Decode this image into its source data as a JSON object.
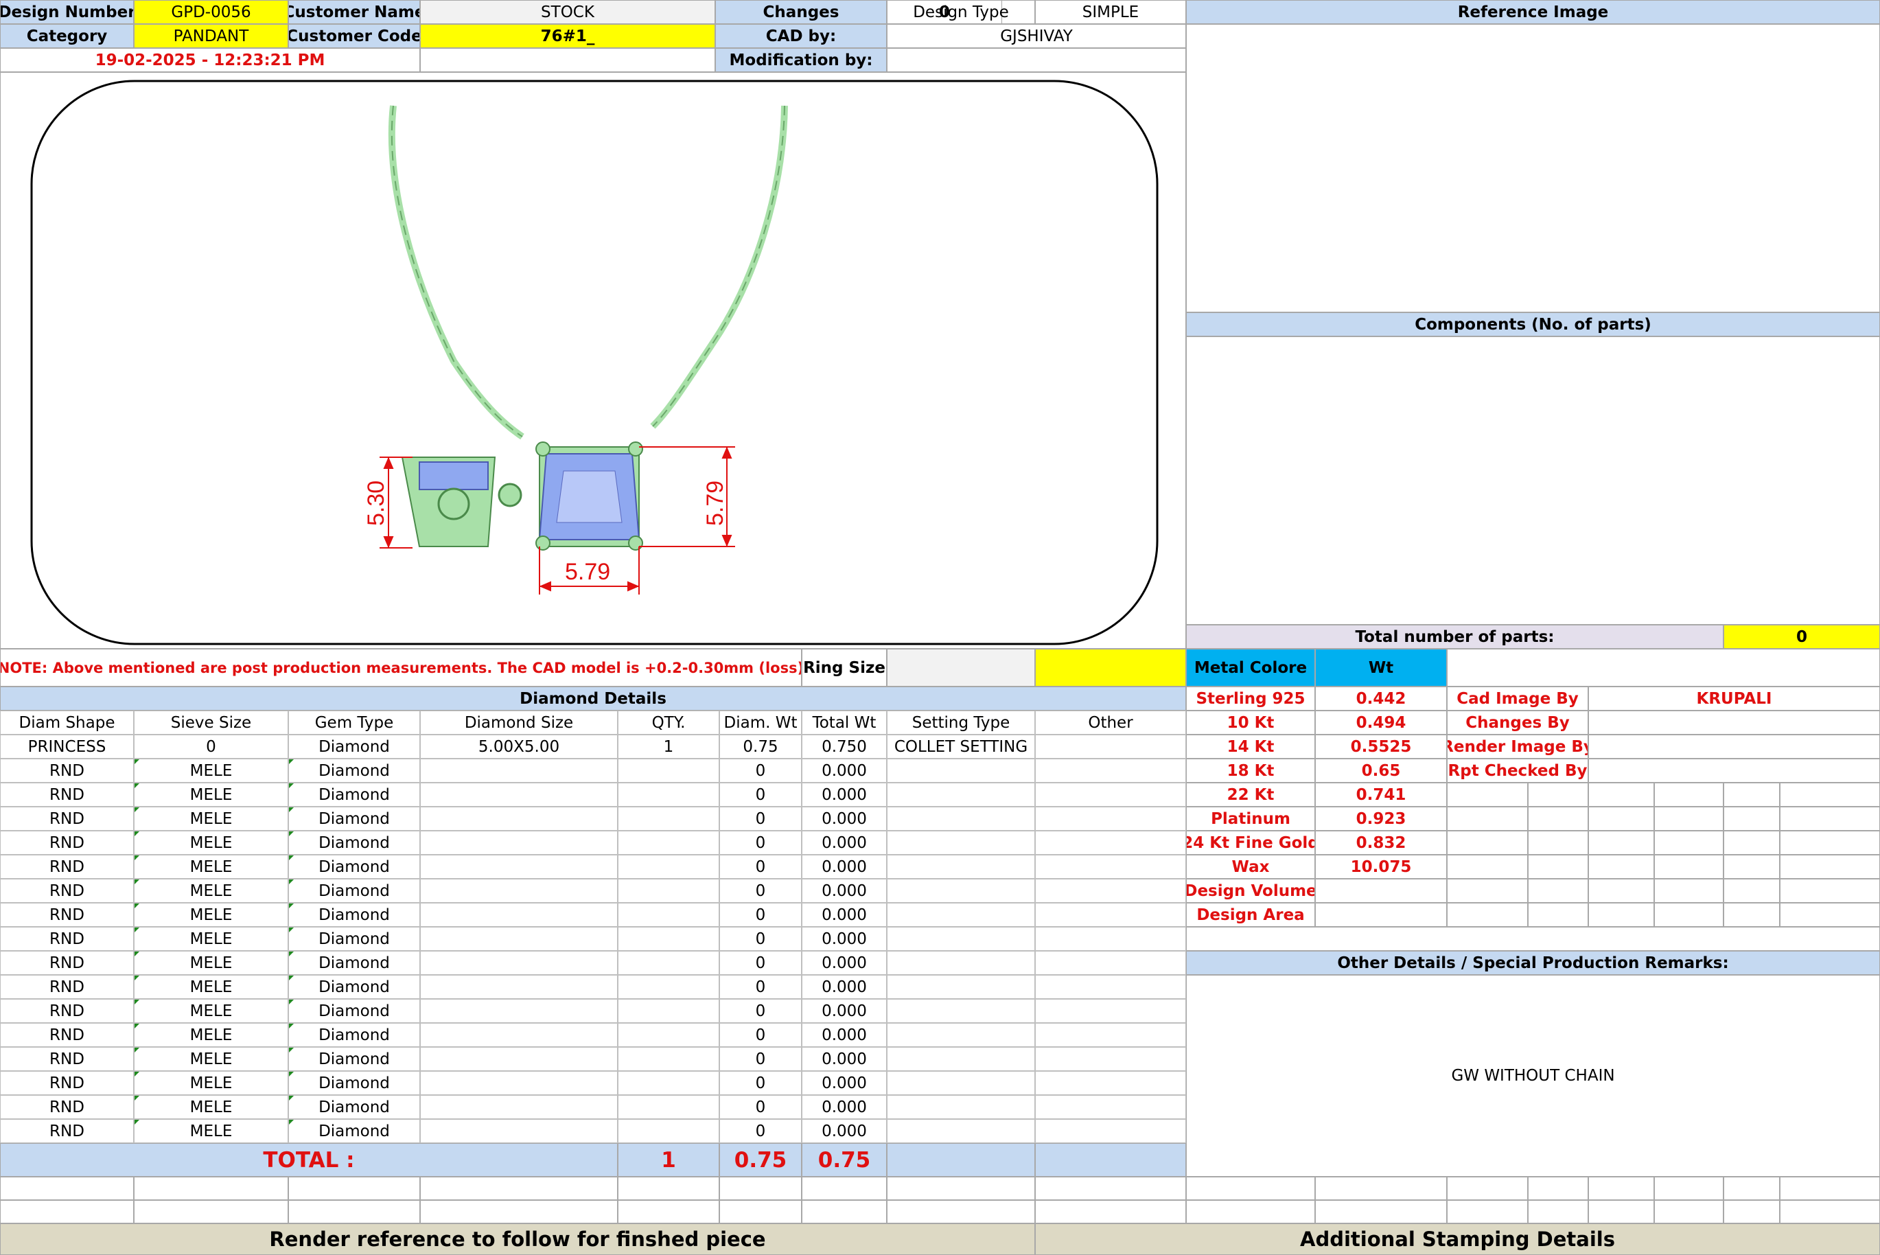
{
  "header": {
    "design_number_label": "Design Number",
    "design_number": "GPD-0056",
    "customer_name_label": "Customer Name",
    "customer_name": "STOCK",
    "changes_label": "Changes",
    "changes": "0",
    "design_type_label": "Design Type",
    "design_type": "SIMPLE",
    "reference_image_label": "Reference Image",
    "category_label": "Category",
    "category": "PANDANT",
    "customer_code_label": "Customer Code",
    "customer_code": "76#1_",
    "cad_by_label": "CAD by:",
    "cad_by": "GJSHIVAY",
    "timestamp": "19-02-2025 - 12:23:21 PM",
    "modification_by_label": "Modification by:",
    "modification_by": ""
  },
  "drawing": {
    "dim_side_height": "5.30",
    "dim_front_height": "5.79",
    "dim_front_width": "5.79"
  },
  "components": {
    "title": "Components (No. of parts)",
    "total_label": "Total number of parts:",
    "total_value": "0"
  },
  "note": "NOTE: Above mentioned are post production measurements. The CAD model is +0.2-0.30mm (loss)",
  "ring_size_label": "Ring Size",
  "ring_size": "",
  "metal": {
    "color_label": "Metal Colore",
    "wt_label": "Wt",
    "rows": [
      {
        "name": "Sterling 925",
        "wt": "0.442"
      },
      {
        "name": "10 Kt",
        "wt": "0.494"
      },
      {
        "name": "14 Kt",
        "wt": "0.5525"
      },
      {
        "name": "18 Kt",
        "wt": "0.65"
      },
      {
        "name": "22 Kt",
        "wt": "0.741"
      },
      {
        "name": "Platinum",
        "wt": "0.923"
      },
      {
        "name": "24 Kt Fine Gold",
        "wt": "0.832"
      },
      {
        "name": "Wax",
        "wt": "10.075"
      },
      {
        "name": "Design Volume",
        "wt": ""
      },
      {
        "name": "Design Area",
        "wt": ""
      }
    ]
  },
  "credits": [
    {
      "label": "Cad Image By",
      "value": "KRUPALI"
    },
    {
      "label": "Changes By",
      "value": ""
    },
    {
      "label": "Render Image By",
      "value": ""
    },
    {
      "label": "Rpt Checked By",
      "value": ""
    }
  ],
  "diamond": {
    "title": "Diamond Details",
    "headers": [
      "Diam Shape",
      "Sieve Size",
      "Gem Type",
      "Diamond Size",
      "QTY.",
      "Diam. Wt",
      "Total Wt",
      "Setting Type",
      "Other"
    ],
    "rows": [
      [
        "PRINCESS",
        "0",
        "Diamond",
        "5.00X5.00",
        "1",
        "0.75",
        "0.750",
        "COLLET SETTING",
        ""
      ],
      [
        "RND",
        "MELE",
        "Diamond",
        "",
        "",
        "0",
        "0.000",
        "",
        ""
      ],
      [
        "RND",
        "MELE",
        "Diamond",
        "",
        "",
        "0",
        "0.000",
        "",
        ""
      ],
      [
        "RND",
        "MELE",
        "Diamond",
        "",
        "",
        "0",
        "0.000",
        "",
        ""
      ],
      [
        "RND",
        "MELE",
        "Diamond",
        "",
        "",
        "0",
        "0.000",
        "",
        ""
      ],
      [
        "RND",
        "MELE",
        "Diamond",
        "",
        "",
        "0",
        "0.000",
        "",
        ""
      ],
      [
        "RND",
        "MELE",
        "Diamond",
        "",
        "",
        "0",
        "0.000",
        "",
        ""
      ],
      [
        "RND",
        "MELE",
        "Diamond",
        "",
        "",
        "0",
        "0.000",
        "",
        ""
      ],
      [
        "RND",
        "MELE",
        "Diamond",
        "",
        "",
        "0",
        "0.000",
        "",
        ""
      ],
      [
        "RND",
        "MELE",
        "Diamond",
        "",
        "",
        "0",
        "0.000",
        "",
        ""
      ],
      [
        "RND",
        "MELE",
        "Diamond",
        "",
        "",
        "0",
        "0.000",
        "",
        ""
      ],
      [
        "RND",
        "MELE",
        "Diamond",
        "",
        "",
        "0",
        "0.000",
        "",
        ""
      ],
      [
        "RND",
        "MELE",
        "Diamond",
        "",
        "",
        "0",
        "0.000",
        "",
        ""
      ],
      [
        "RND",
        "MELE",
        "Diamond",
        "",
        "",
        "0",
        "0.000",
        "",
        ""
      ],
      [
        "RND",
        "MELE",
        "Diamond",
        "",
        "",
        "0",
        "0.000",
        "",
        ""
      ],
      [
        "RND",
        "MELE",
        "Diamond",
        "",
        "",
        "0",
        "0.000",
        "",
        ""
      ],
      [
        "RND",
        "MELE",
        "Diamond",
        "",
        "",
        "0",
        "0.000",
        "",
        ""
      ]
    ],
    "total_label": "TOTAL :",
    "total_qty": "1",
    "total_diam_wt": "0.75",
    "total_wt": "0.75"
  },
  "remarks": {
    "title": "Other Details / Special Production Remarks:",
    "text": "GW WITHOUT CHAIN"
  },
  "footer": {
    "render_reference": "Render reference to follow for finshed piece",
    "stamping": "Additional Stamping Details"
  },
  "colors": {
    "header_blue": "#c5d9f1",
    "highlight_yellow": "#ffff00",
    "metal_cyan": "#00b0f0",
    "footer_tan": "#ddd9c4",
    "alert_red": "#e01010",
    "metal_green": "#a8e0a8",
    "stone_blue": "#8fa8f0"
  }
}
